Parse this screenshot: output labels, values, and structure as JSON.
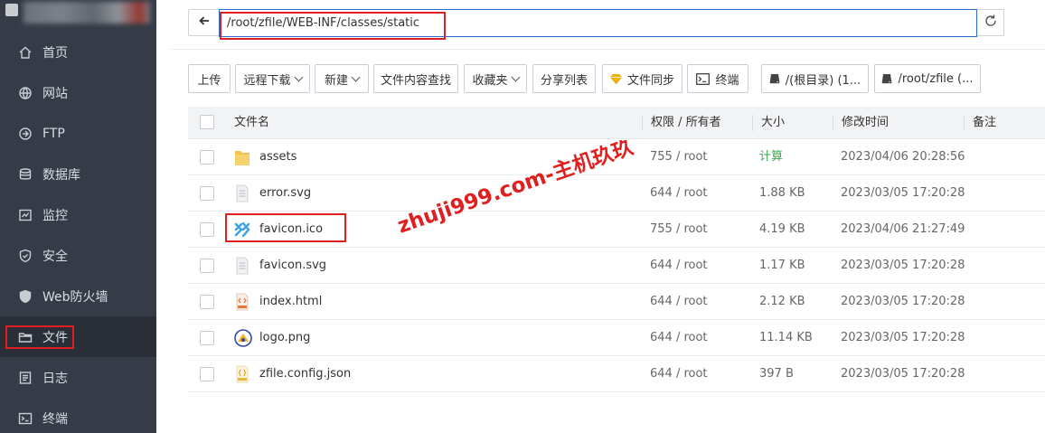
{
  "sidebar": {
    "items": [
      {
        "label": "首页",
        "icon": "home-icon"
      },
      {
        "label": "网站",
        "icon": "globe-icon"
      },
      {
        "label": "FTP",
        "icon": "ftp-icon"
      },
      {
        "label": "数据库",
        "icon": "database-icon"
      },
      {
        "label": "监控",
        "icon": "monitor-icon"
      },
      {
        "label": "安全",
        "icon": "shield-icon"
      },
      {
        "label": "Web防火墙",
        "icon": "firewall-icon"
      },
      {
        "label": "文件",
        "icon": "folder-icon",
        "active": true
      },
      {
        "label": "日志",
        "icon": "log-icon"
      },
      {
        "label": "终端",
        "icon": "terminal-icon"
      }
    ]
  },
  "pathbar": {
    "path": "/root/zfile/WEB-INF/classes/static"
  },
  "toolbar": {
    "upload": "上传",
    "remote_download": "远程下载",
    "new": "新建",
    "search_content": "文件内容查找",
    "favorites": "收藏夹",
    "share_list": "分享列表",
    "file_sync": "文件同步",
    "terminal": "终端",
    "disk_root": "/(根目录) (1...",
    "disk_zfile": "/root/zfile (..."
  },
  "table": {
    "headers": {
      "name": "文件名",
      "perm": "权限 / 所有者",
      "size": "大小",
      "mtime": "修改时间",
      "note": "备注"
    },
    "rows": [
      {
        "name": "assets",
        "perm": "755 / root",
        "size": "计算",
        "mtime": "2023/04/06 20:28:56",
        "type": "folder"
      },
      {
        "name": "error.svg",
        "perm": "644 / root",
        "size": "1.88 KB",
        "mtime": "2023/03/05 17:20:28",
        "type": "doc"
      },
      {
        "name": "favicon.ico",
        "perm": "755 / root",
        "size": "4.19 KB",
        "mtime": "2023/04/06 21:27:49",
        "type": "ico"
      },
      {
        "name": "favicon.svg",
        "perm": "644 / root",
        "size": "1.17 KB",
        "mtime": "2023/03/05 17:20:28",
        "type": "doc"
      },
      {
        "name": "index.html",
        "perm": "644 / root",
        "size": "2.12 KB",
        "mtime": "2023/03/05 17:20:28",
        "type": "html"
      },
      {
        "name": "logo.png",
        "perm": "644 / root",
        "size": "11.14 KB",
        "mtime": "2023/03/05 17:20:28",
        "type": "png"
      },
      {
        "name": "zfile.config.json",
        "perm": "644 / root",
        "size": "397 B",
        "mtime": "2023/03/05 17:20:28",
        "type": "json"
      }
    ]
  },
  "watermark": "zhuji999.com-主机玖玖",
  "colors": {
    "sidebar_bg": "#353c47",
    "highlight_red": "#e02020",
    "accent_blue": "#2a6cd4",
    "size_green": "#3aa84a"
  }
}
